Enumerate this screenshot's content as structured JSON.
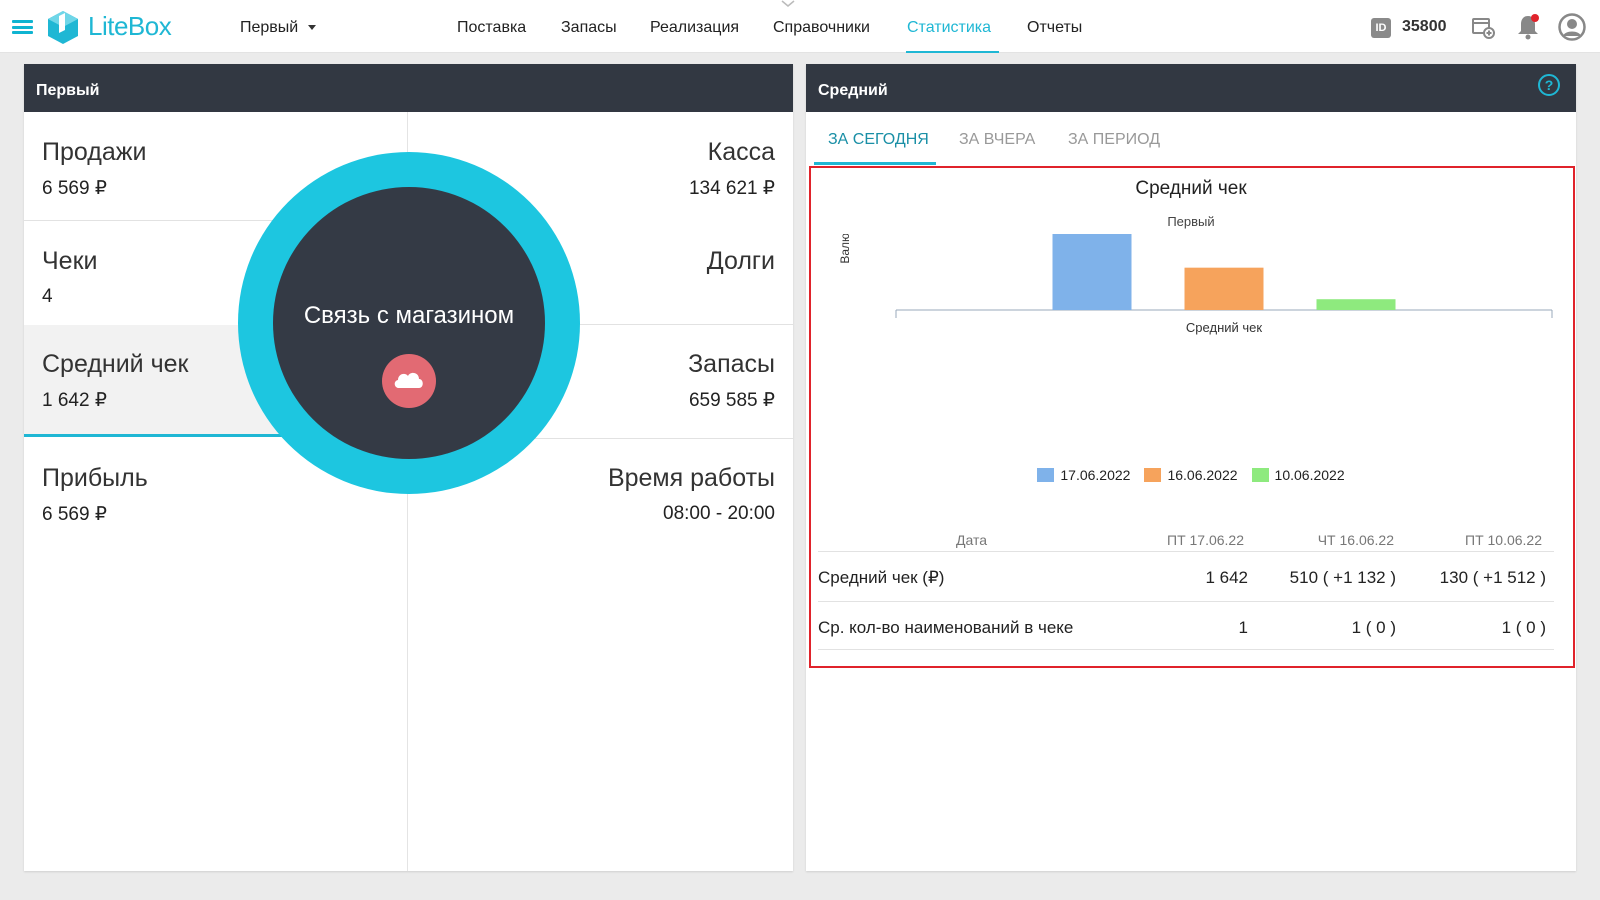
{
  "header": {
    "brand": "LiteBox",
    "store": "Первый",
    "nav": [
      "Поставка",
      "Запасы",
      "Реализация",
      "Справочники",
      "Статистика",
      "Отчеты"
    ],
    "active_nav": "Статистика",
    "id_badge": "ID",
    "id_number": "35800",
    "colors": {
      "accent": "#1fb7d4",
      "notification_dot": "#e0232b"
    }
  },
  "left_panel": {
    "title": "Первый",
    "stats": {
      "sales": {
        "label": "Продажи",
        "value": "6 569 ₽"
      },
      "cash": {
        "label": "Касса",
        "value": "134 621 ₽"
      },
      "checks": {
        "label": "Чеки",
        "value": "4"
      },
      "debts": {
        "label": "Долги",
        "value": ""
      },
      "avg_check": {
        "label": "Средний чек",
        "value": "1 642 ₽"
      },
      "stock": {
        "label": "Запасы",
        "value": "659 585 ₽"
      },
      "profit": {
        "label": "Прибыль",
        "value": "6 569 ₽"
      },
      "hours": {
        "label": "Время работы",
        "value": "08:00 - 20:00"
      }
    }
  },
  "overlay": {
    "text": "Связь с магазином",
    "icon": "cloud-icon"
  },
  "right_panel": {
    "title": "Средний",
    "tabs": [
      "ЗА СЕГОДНЯ",
      "ЗА ВЧЕРА",
      "ЗА ПЕРИОД"
    ],
    "active_tab": "ЗА СЕГОДНЯ",
    "table": {
      "header": [
        "Дата",
        "ПТ 17.06.22",
        "ЧТ 16.06.22",
        "ПТ 10.06.22"
      ],
      "rows": [
        {
          "label": "Средний чек (₽)",
          "values": [
            "1 642",
            "510 ( +1 132 )",
            "130 ( +1 512 )"
          ]
        },
        {
          "label": "Ср. кол-во наименований в чеке",
          "values": [
            "1",
            "1 ( 0 )",
            "1 ( 0 )"
          ]
        }
      ]
    }
  },
  "chart_data": {
    "type": "bar",
    "title": "Средний чек",
    "subtitle": "Первый",
    "ylabel": "Валюта (руб)",
    "xlabel": "Средний чек",
    "categories": [
      "Средний чек"
    ],
    "series": [
      {
        "name": "17.06.2022",
        "values": [
          1642
        ],
        "color": "#7fb2ea"
      },
      {
        "name": "16.06.2022",
        "values": [
          510
        ],
        "color": "#f6a35c"
      },
      {
        "name": "10.06.2022",
        "values": [
          130
        ],
        "color": "#8eea7e"
      }
    ],
    "ylim": [
      0,
      2000
    ],
    "grid": true,
    "legend": "bottom"
  }
}
